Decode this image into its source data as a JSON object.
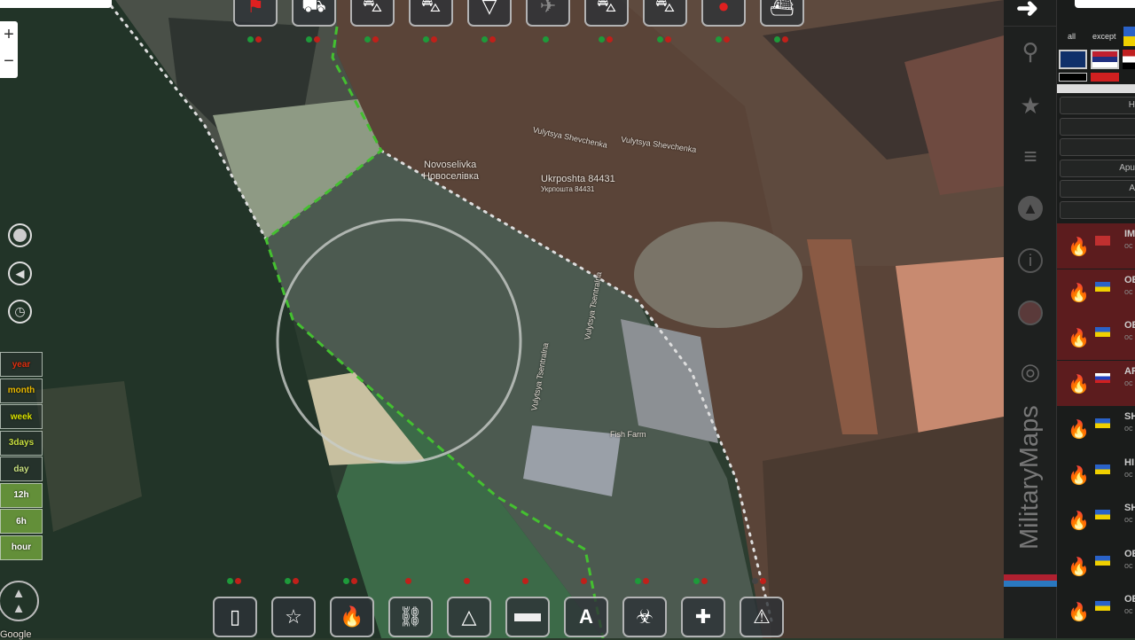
{
  "map": {
    "labels": {
      "village_en": "Novoselivka",
      "village_uk": "Новоселівка",
      "post": "Ukrposhta 84431",
      "post_uk": "Укрпошта 84431",
      "street1": "Vulytsya Shevchenka",
      "street2": "Vulytsya Shevchenka",
      "street3": "Vulytsya Tsentralna",
      "street4": "Vulytsya Tsentralna",
      "fish": "Fish Farm",
      "google": "Google"
    }
  },
  "zoom": {
    "in": "+",
    "out": "−"
  },
  "top_toolbar": [
    {
      "icon": "flag-red-icon"
    },
    {
      "icon": "vehicle-icon"
    },
    {
      "icon": "missile-launcher-icon"
    },
    {
      "icon": "artillery-icon"
    },
    {
      "icon": "paratrooper-icon"
    },
    {
      "icon": "aircraft-icon"
    },
    {
      "icon": "tank-icon"
    },
    {
      "icon": "sam-launcher-icon"
    },
    {
      "icon": "soldier-icon"
    },
    {
      "icon": "ship-icon"
    }
  ],
  "bottom_toolbar": [
    {
      "icon": "calendar-icon"
    },
    {
      "icon": "star-icon"
    },
    {
      "icon": "fire-icon"
    },
    {
      "icon": "route-icon"
    },
    {
      "icon": "triangle-nodes-icon"
    },
    {
      "icon": "ruler-icon"
    },
    {
      "icon": "text-icon",
      "label": "A"
    },
    {
      "icon": "biohazard-icon"
    },
    {
      "icon": "medical-cross-icon"
    },
    {
      "icon": "warning-icon"
    }
  ],
  "time_filters": [
    {
      "label": "year",
      "color": "#e03010"
    },
    {
      "label": "month",
      "color": "#e8b800"
    },
    {
      "label": "week",
      "color": "#d8e000"
    },
    {
      "label": "3days",
      "color": "#c8e040"
    },
    {
      "label": "day",
      "color": "#c8e080"
    },
    {
      "label": "12h",
      "color": "#ffffff"
    },
    {
      "label": "6h",
      "color": "#ffffff"
    },
    {
      "label": "hour",
      "color": "#ffffff"
    }
  ],
  "sidebar": {
    "brand": "MilitaryMaps",
    "filter_all": "all",
    "filter_except": "except"
  },
  "filter_buttons": [
    "H",
    "",
    "",
    "Apu",
    "A",
    ""
  ],
  "events": [
    {
      "title": "IM",
      "sub": "oc",
      "flag": "novorossiya",
      "highlight": true
    },
    {
      "title": "OE",
      "sub": "oc",
      "flag": "ua",
      "highlight": true
    },
    {
      "title": "OE",
      "sub": "oc",
      "flag": "ua",
      "highlight": true
    },
    {
      "title": "AR",
      "sub": "oc",
      "flag": "ru",
      "highlight": true
    },
    {
      "title": "SH",
      "sub": "oc",
      "flag": "ua",
      "highlight": false
    },
    {
      "title": "HI",
      "sub": "oc",
      "flag": "ua",
      "highlight": false
    },
    {
      "title": "SH",
      "sub": "oc",
      "flag": "ua",
      "highlight": false
    },
    {
      "title": "OE",
      "sub": "oc",
      "flag": "ua",
      "highlight": false
    },
    {
      "title": "OE",
      "sub": "oc",
      "flag": "ua",
      "highlight": false
    }
  ]
}
